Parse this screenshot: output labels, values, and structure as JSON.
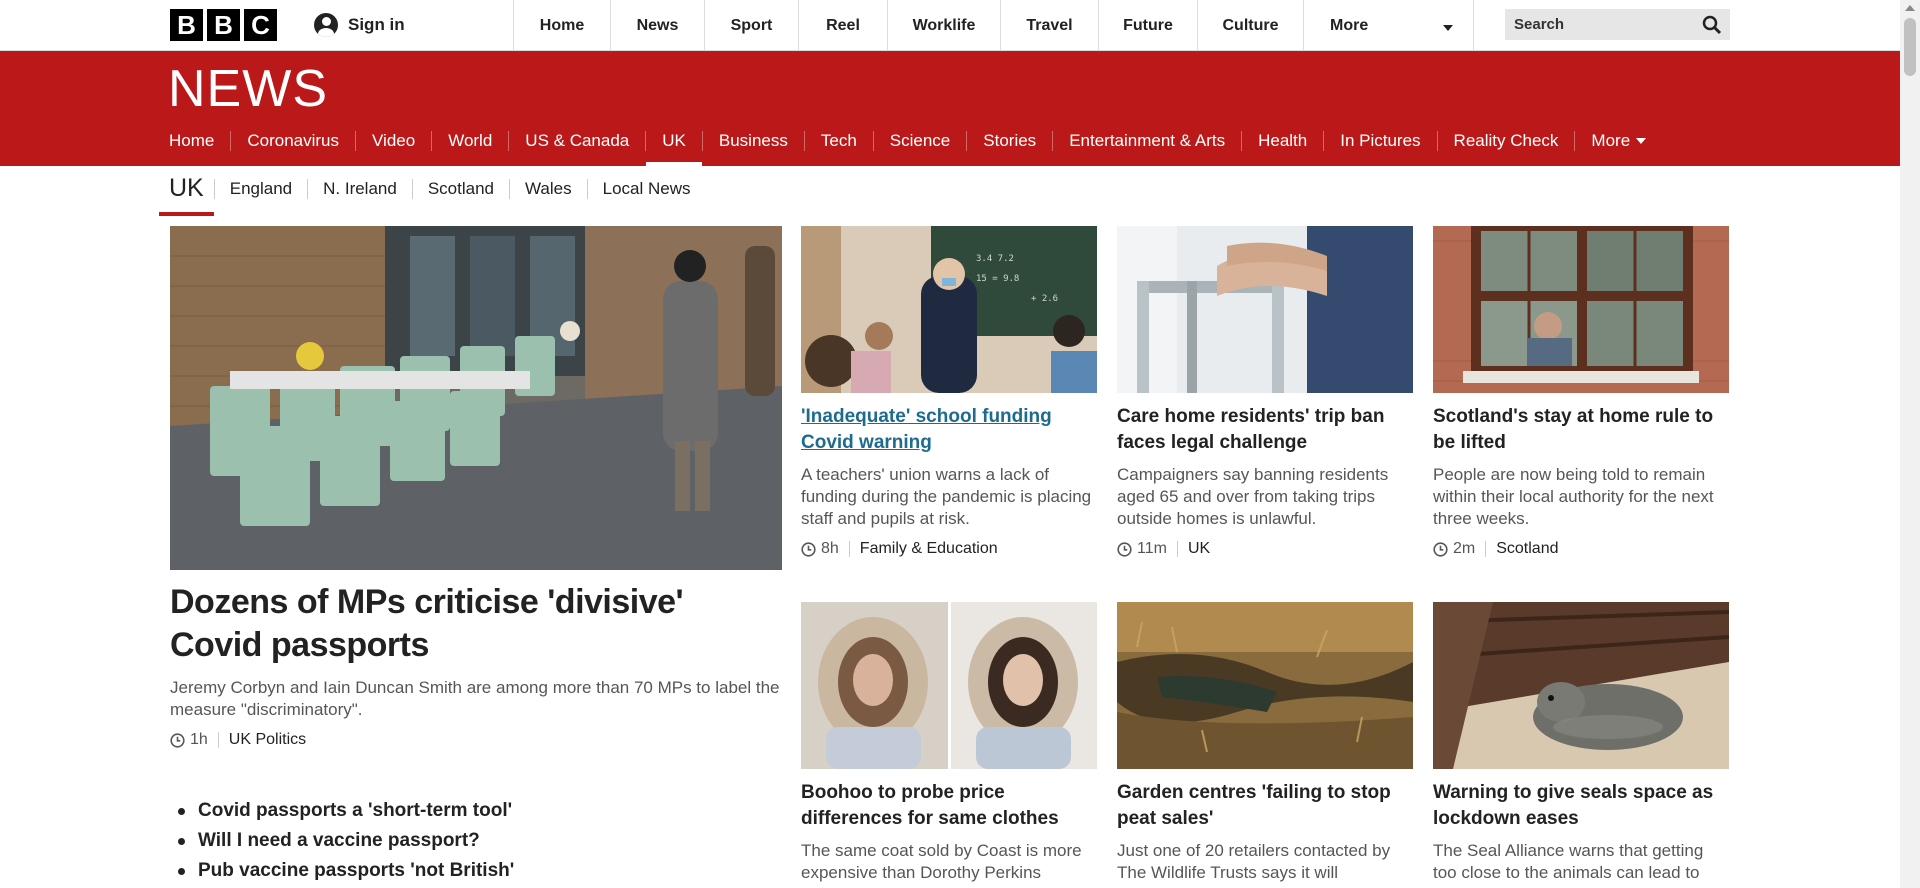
{
  "masthead": {
    "logo_letters": [
      "B",
      "B",
      "C"
    ],
    "signin_label": "Sign in",
    "nav": [
      "Home",
      "News",
      "Sport",
      "Reel",
      "Worklife",
      "Travel",
      "Future",
      "Culture"
    ],
    "more_label": "More",
    "search_placeholder": "Search"
  },
  "news": {
    "title": "NEWS",
    "nav": [
      "Home",
      "Coronavirus",
      "Video",
      "World",
      "US & Canada",
      "UK",
      "Business",
      "Tech",
      "Science",
      "Stories",
      "Entertainment & Arts",
      "Health",
      "In Pictures",
      "Reality Check"
    ],
    "active": "UK",
    "more_label": "More",
    "brand_color": "#bb1919"
  },
  "subnav": {
    "current": "UK",
    "items": [
      "England",
      "N. Ireland",
      "Scotland",
      "Wales",
      "Local News"
    ]
  },
  "lead": {
    "title": "Dozens of MPs criticise 'divisive' Covid passports",
    "summary": "Jeremy Corbyn and Iain Duncan Smith are among more than 70 MPs to label the measure \"discriminatory\".",
    "time": "1h",
    "section": "UK Politics",
    "related": [
      "Covid passports a 'short-term tool'",
      "Will I need a vaccine passport?",
      "Pub vaccine passports 'not British'"
    ]
  },
  "cards": [
    {
      "title": "'Inadequate' school funding Covid warning",
      "summary": "A teachers' union warns a lack of funding during the pandemic is placing staff and pupils at risk.",
      "time": "8h",
      "section": "Family & Education",
      "hovered": true
    },
    {
      "title": "Care home residents' trip ban faces legal challenge",
      "summary": "Campaigners say banning residents aged 65 and over from taking trips outside homes is unlawful.",
      "time": "11m",
      "section": "UK"
    },
    {
      "title": "Scotland's stay at home rule to be lifted",
      "summary": "People are now being told to remain within their local authority for the next three weeks.",
      "time": "2m",
      "section": "Scotland"
    },
    {
      "title": "Boohoo to probe price differences for same clothes",
      "summary": "The same coat sold by Coast is more expensive than Dorothy Perkins"
    },
    {
      "title": "Garden centres 'failing to stop peat sales'",
      "summary": "Just one of 20 retailers contacted by The Wildlife Trusts says it will"
    },
    {
      "title": "Warning to give seals space as lockdown eases",
      "summary": "The Seal Alliance warns that getting too close to the animals can lead to"
    }
  ]
}
